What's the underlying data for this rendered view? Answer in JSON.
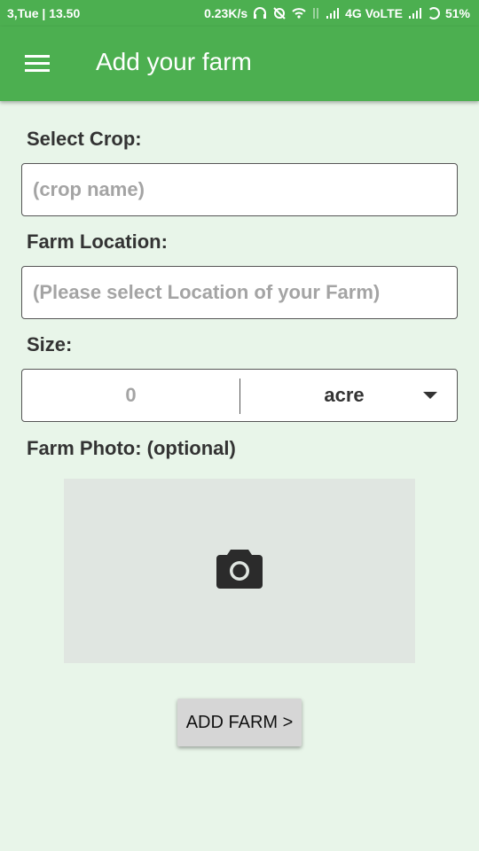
{
  "status_bar": {
    "left_text": "3,Tue | 13.50",
    "speed": "0.23K/s",
    "network": "4G VoLTE",
    "battery": "51%"
  },
  "app_bar": {
    "title": "Add your farm"
  },
  "form": {
    "crop": {
      "label": "Select Crop:",
      "placeholder": "(crop name)",
      "value": ""
    },
    "location": {
      "label": "Farm Location:",
      "placeholder": "(Please select Location of your Farm)",
      "value": ""
    },
    "size": {
      "label": "Size:",
      "value": "0",
      "unit": "acre"
    },
    "photo": {
      "label": "Farm Photo: (optional)"
    }
  },
  "actions": {
    "add_farm_label": "ADD FARM >"
  },
  "colors": {
    "primary": "#4caf50",
    "background": "#e8f5e9",
    "photo_placeholder": "#e0e6e1",
    "button": "#d6d6d6"
  }
}
